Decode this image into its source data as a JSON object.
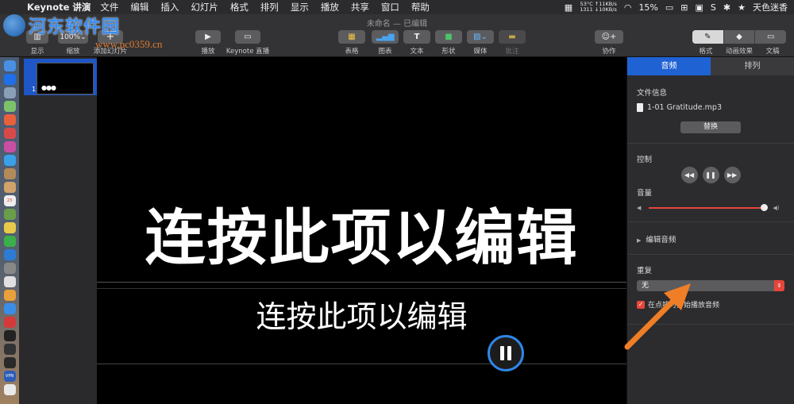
{
  "menubar": {
    "app_name": "Keynote 讲演",
    "menus": [
      "文件",
      "编辑",
      "插入",
      "幻灯片",
      "格式",
      "排列",
      "显示",
      "播放",
      "共享",
      "窗口",
      "帮助"
    ],
    "temp": "53°C",
    "cpu": "1311",
    "net_up": "↑11KB/s",
    "net_down": "↓10KB/s",
    "battery": "15%",
    "user": "天色迷香"
  },
  "toolbar": {
    "doc_title": "未命名 — 已编辑",
    "zoom": "100%",
    "buttons": {
      "show": "显示",
      "zoom": "缩放",
      "add_slide": "添加幻灯片",
      "play": "播放",
      "keynote_live": "Keynote 直播",
      "table": "表格",
      "chart": "图表",
      "text": "文本",
      "shape": "形状",
      "media": "媒体",
      "comment": "批注",
      "collaborate": "协作",
      "format": "格式",
      "animate": "动画效果",
      "document": "文稿"
    }
  },
  "watermark": {
    "title": "河东软件园",
    "url": "www.pc0359.cn"
  },
  "navigator": {
    "slide_number": "1",
    "thumb_dots": "●●●"
  },
  "slide": {
    "title": "连按此项以编辑",
    "body": "连按此项以编辑"
  },
  "inspector": {
    "tabs": [
      "音频",
      "排列"
    ],
    "file_info_label": "文件信息",
    "file_name": "1-01 Gratitude.mp3",
    "replace_label": "替换",
    "control_label": "控制",
    "volume_label": "音量",
    "volume_level": 0.98,
    "edit_audio_label": "编辑音频",
    "repeat_label": "重复",
    "repeat_value": "无",
    "autoplay_label": "在点按时开始播放音频"
  },
  "colors": {
    "accent_blue": "#1f62d4",
    "accent_red": "#e8453c",
    "annotation_orange": "#f07e26"
  }
}
